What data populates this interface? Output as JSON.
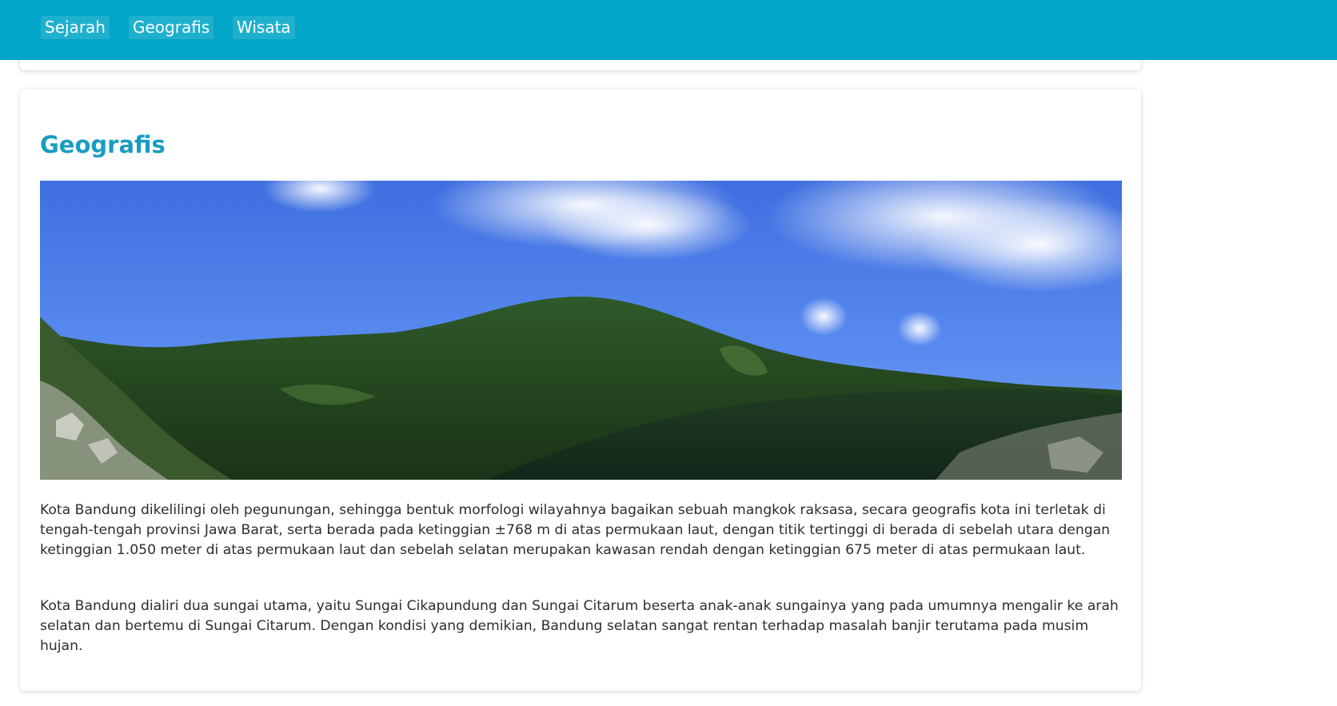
{
  "nav": {
    "items": [
      "Sejarah",
      "Geografis",
      "Wisata"
    ]
  },
  "section": {
    "title": "Geografis",
    "image_alt": "Panorama pegunungan hijau di bawah langit biru berawan",
    "paragraphs": [
      "Kota Bandung dikelilingi oleh pegunungan, sehingga bentuk morfologi wilayahnya bagaikan sebuah mangkok raksasa, secara geografis kota ini terletak di tengah-tengah provinsi Jawa Barat, serta berada pada ketinggian ±768 m di atas permukaan laut, dengan titik tertinggi di berada di sebelah utara dengan ketinggian 1.050 meter di atas permukaan laut dan sebelah selatan merupakan kawasan rendah dengan ketinggian 675 meter di atas permukaan laut.",
      "Kota Bandung dialiri dua sungai utama, yaitu Sungai Cikapundung dan Sungai Citarum beserta anak-anak sungainya yang pada umumnya mengalir ke arah selatan dan bertemu di Sungai Citarum. Dengan kondisi yang demikian, Bandung selatan sangat rentan terhadap masalah banjir terutama pada musim hujan."
    ]
  },
  "colors": {
    "navbar": "#00a5c8",
    "title": "#1a9cc1",
    "text": "#2e2e2e"
  }
}
